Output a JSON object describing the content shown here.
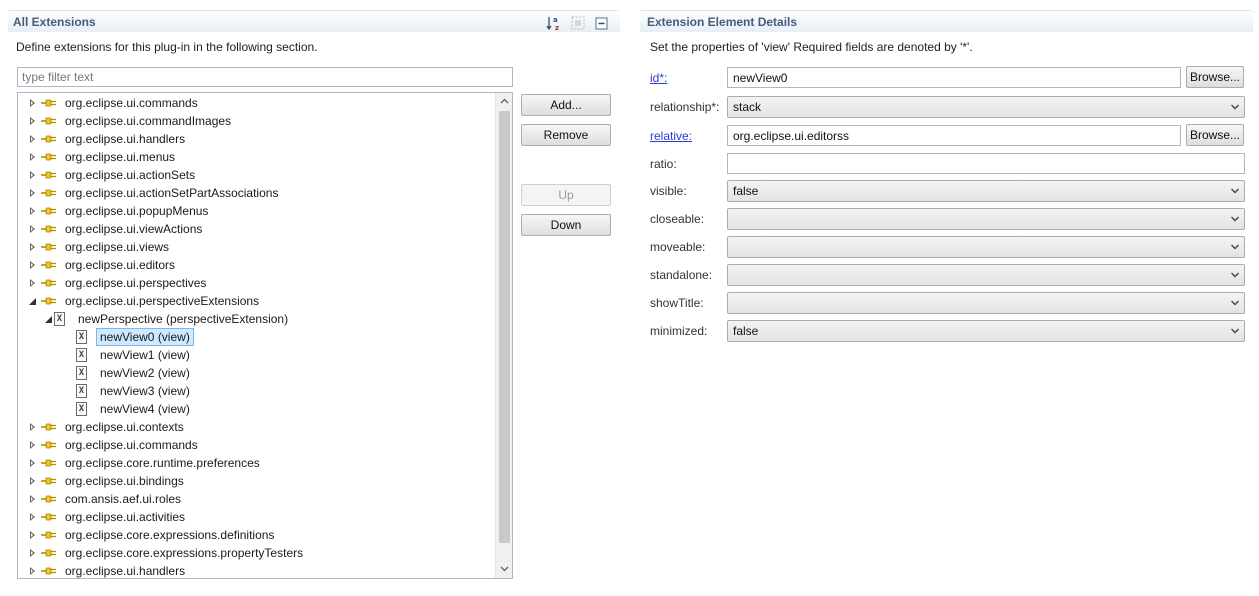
{
  "left": {
    "title": "All Extensions",
    "description": "Define extensions for this plug-in in the following section.",
    "filter_placeholder": "type filter text",
    "tree": [
      {
        "label": "org.eclipse.ui.commands",
        "level": 0,
        "twisty": "collapsed",
        "icon": "plug"
      },
      {
        "label": "org.eclipse.ui.commandImages",
        "level": 0,
        "twisty": "collapsed",
        "icon": "plug"
      },
      {
        "label": "org.eclipse.ui.handlers",
        "level": 0,
        "twisty": "collapsed",
        "icon": "plug"
      },
      {
        "label": "org.eclipse.ui.menus",
        "level": 0,
        "twisty": "collapsed",
        "icon": "plug"
      },
      {
        "label": "org.eclipse.ui.actionSets",
        "level": 0,
        "twisty": "collapsed",
        "icon": "plug"
      },
      {
        "label": "org.eclipse.ui.actionSetPartAssociations",
        "level": 0,
        "twisty": "collapsed",
        "icon": "plug"
      },
      {
        "label": "org.eclipse.ui.popupMenus",
        "level": 0,
        "twisty": "collapsed",
        "icon": "plug"
      },
      {
        "label": "org.eclipse.ui.viewActions",
        "level": 0,
        "twisty": "collapsed",
        "icon": "plug"
      },
      {
        "label": "org.eclipse.ui.views",
        "level": 0,
        "twisty": "collapsed",
        "icon": "plug"
      },
      {
        "label": "org.eclipse.ui.editors",
        "level": 0,
        "twisty": "collapsed",
        "icon": "plug"
      },
      {
        "label": "org.eclipse.ui.perspectives",
        "level": 0,
        "twisty": "collapsed",
        "icon": "plug"
      },
      {
        "label": "org.eclipse.ui.perspectiveExtensions",
        "level": 0,
        "twisty": "expanded",
        "icon": "plug"
      },
      {
        "label": "newPerspective (perspectiveExtension)",
        "level": 1,
        "twisty": "expanded",
        "icon": "xml"
      },
      {
        "label": "newView0 (view)",
        "level": 2,
        "twisty": "none",
        "icon": "xml",
        "selected": true
      },
      {
        "label": "newView1 (view)",
        "level": 2,
        "twisty": "none",
        "icon": "xml"
      },
      {
        "label": "newView2 (view)",
        "level": 2,
        "twisty": "none",
        "icon": "xml"
      },
      {
        "label": "newView3 (view)",
        "level": 2,
        "twisty": "none",
        "icon": "xml"
      },
      {
        "label": "newView4 (view)",
        "level": 2,
        "twisty": "none",
        "icon": "xml"
      },
      {
        "label": "org.eclipse.ui.contexts",
        "level": 0,
        "twisty": "collapsed",
        "icon": "plug"
      },
      {
        "label": "org.eclipse.ui.commands",
        "level": 0,
        "twisty": "collapsed",
        "icon": "plug"
      },
      {
        "label": "org.eclipse.core.runtime.preferences",
        "level": 0,
        "twisty": "collapsed",
        "icon": "plug"
      },
      {
        "label": "org.eclipse.ui.bindings",
        "level": 0,
        "twisty": "collapsed",
        "icon": "plug"
      },
      {
        "label": "com.ansis.aef.ui.roles",
        "level": 0,
        "twisty": "collapsed",
        "icon": "plug"
      },
      {
        "label": "org.eclipse.ui.activities",
        "level": 0,
        "twisty": "collapsed",
        "icon": "plug"
      },
      {
        "label": "org.eclipse.core.expressions.definitions",
        "level": 0,
        "twisty": "collapsed",
        "icon": "plug"
      },
      {
        "label": "org.eclipse.core.expressions.propertyTesters",
        "level": 0,
        "twisty": "collapsed",
        "icon": "plug"
      },
      {
        "label": "org.eclipse.ui.handlers",
        "level": 0,
        "twisty": "collapsed",
        "icon": "plug"
      }
    ],
    "buttons": {
      "add": "Add...",
      "remove": "Remove",
      "up": "Up",
      "down": "Down"
    }
  },
  "right": {
    "title": "Extension Element Details",
    "description": "Set the properties of 'view' Required fields are denoted by '*'.",
    "browse_label": "Browse...",
    "fields": {
      "id": {
        "label": "id*:",
        "value": "newView0"
      },
      "relationship": {
        "label": "relationship*:",
        "value": "stack"
      },
      "relative": {
        "label": "relative:",
        "value": "org.eclipse.ui.editorss"
      },
      "ratio": {
        "label": "ratio:",
        "value": ""
      },
      "visible": {
        "label": "visible:",
        "value": "false"
      },
      "closeable": {
        "label": "closeable:",
        "value": ""
      },
      "moveable": {
        "label": "moveable:",
        "value": ""
      },
      "standalone": {
        "label": "standalone:",
        "value": ""
      },
      "showTitle": {
        "label": "showTitle:",
        "value": ""
      },
      "minimized": {
        "label": "minimized:",
        "value": "false"
      }
    }
  },
  "colors": {
    "header_title": "#445d7a",
    "selection_bg": "#cde8ff",
    "link": "#2a3bd0"
  }
}
